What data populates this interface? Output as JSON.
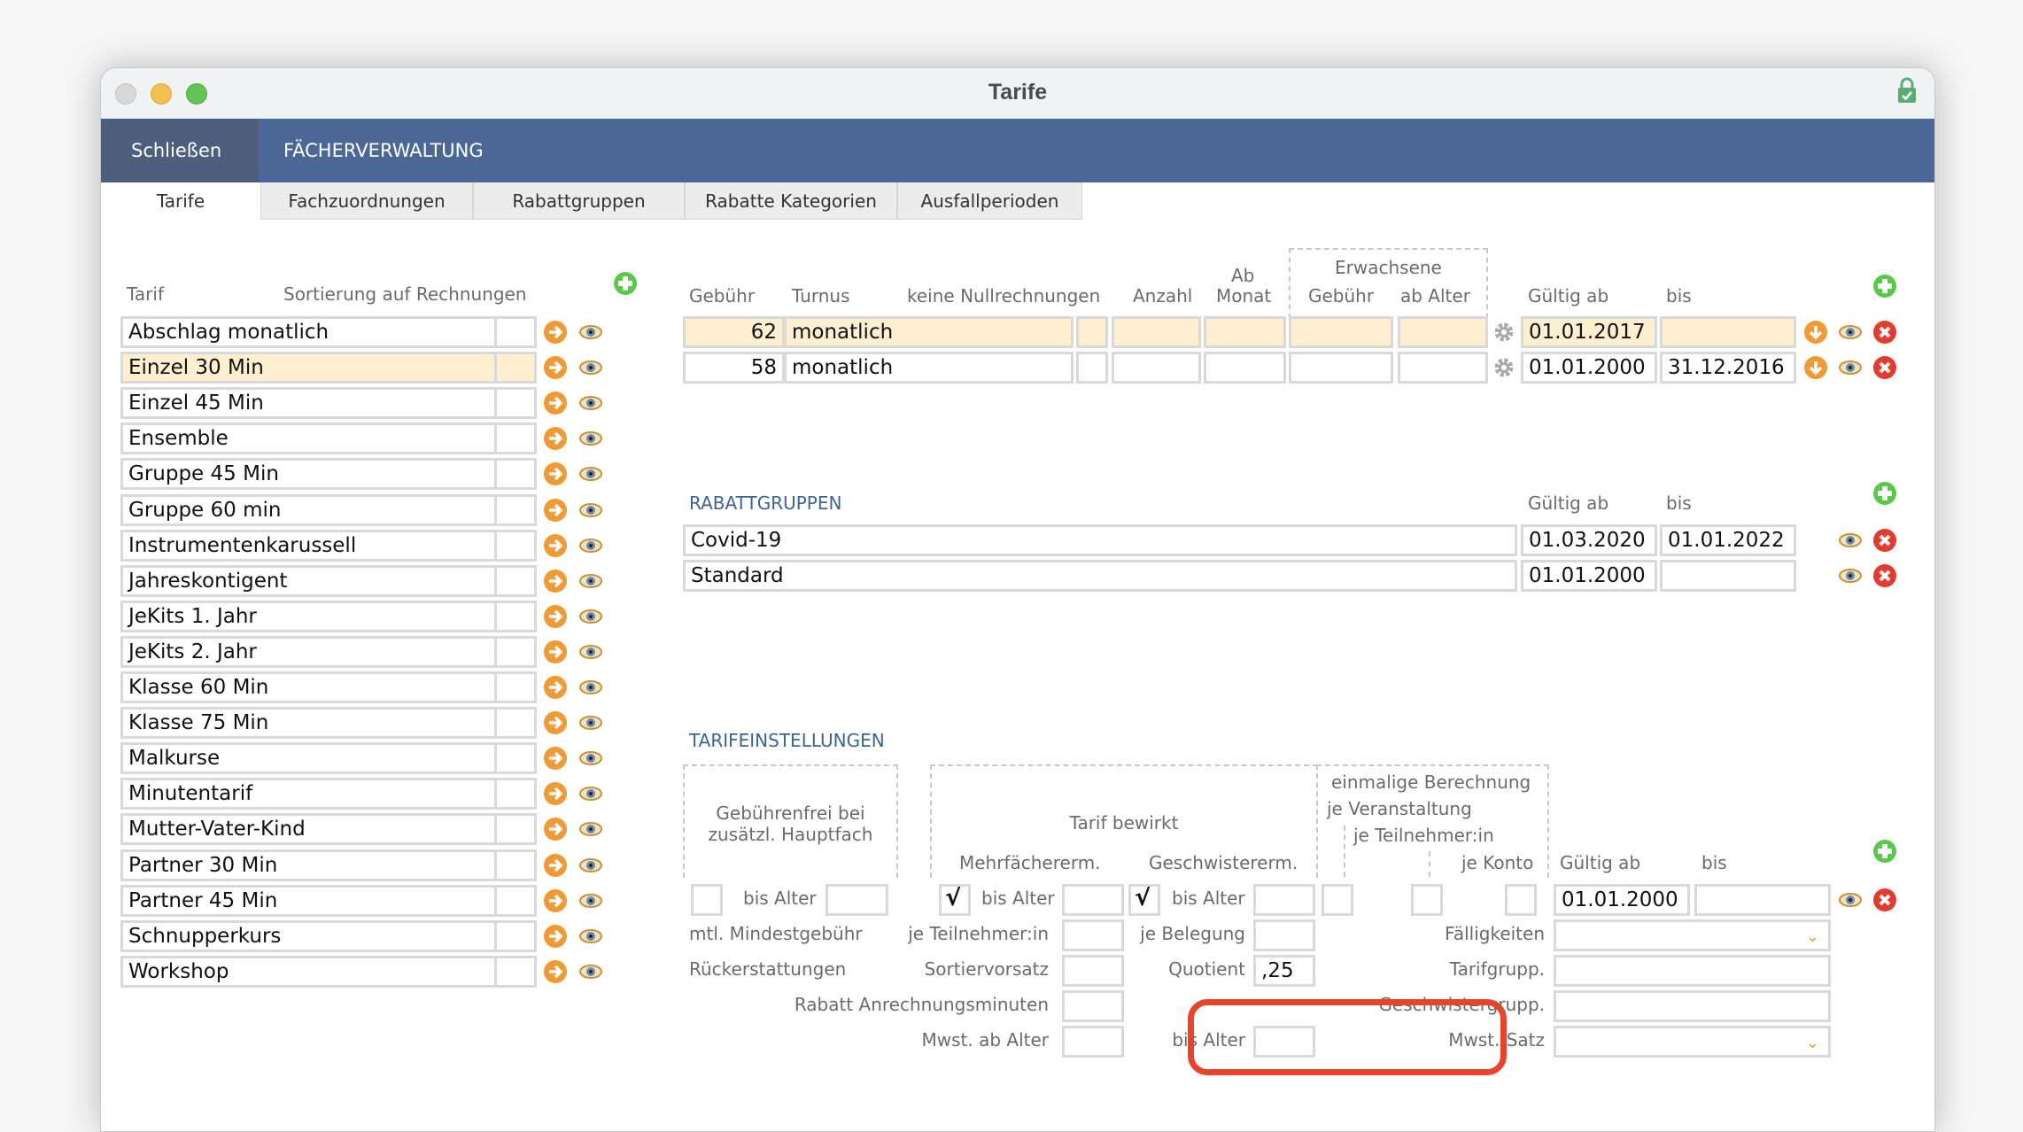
{
  "window": {
    "title": "Tarife"
  },
  "navbar": {
    "close_label": "Schließen",
    "module_label": "FÄCHERVERWALTUNG"
  },
  "tabs": [
    {
      "label": "Tarife",
      "active": true
    },
    {
      "label": "Fachzuordnungen"
    },
    {
      "label": "Rabattgruppen"
    },
    {
      "label": "Rabatte Kategorien"
    },
    {
      "label": "Ausfallperioden"
    }
  ],
  "tariff_list": {
    "headers": {
      "tarif": "Tarif",
      "sort": "Sortierung auf Rechnungen"
    },
    "selected": "Einzel 30 Min",
    "items": [
      "Abschlag monatlich",
      "Einzel 30 Min",
      "Einzel 45 Min",
      "Ensemble",
      "Gruppe 45 Min",
      "Gruppe 60 min",
      "Instrumentenkarussell",
      "Jahreskontigent",
      "JeKits 1. Jahr",
      "JeKits 2. Jahr",
      "Klasse 60 Min",
      "Klasse 75 Min",
      "Malkurse",
      "Minutentarif",
      "Mutter-Vater-Kind",
      "Partner 30 Min",
      "Partner 45 Min",
      "Schnupperkurs",
      "Workshop"
    ]
  },
  "fees": {
    "headers": {
      "gebuehr": "Gebühr",
      "turnus": "Turnus",
      "keine_null": "keine Nullrechnungen",
      "anzahl": "Anzahl",
      "ab": "Ab",
      "monat": "Monat",
      "erwachsene": "Erwachsene",
      "erw_gebuehr": "Gebühr",
      "ab_alter": "ab Alter",
      "gueltig_ab": "Gültig ab",
      "bis": "bis"
    },
    "rows": [
      {
        "gebuehr": "62",
        "turnus": "monatlich",
        "gueltig_ab": "01.01.2017",
        "bis": "",
        "highlighted": true
      },
      {
        "gebuehr": "58",
        "turnus": "monatlich",
        "gueltig_ab": "01.01.2000",
        "bis": "31.12.2016",
        "highlighted": false
      }
    ]
  },
  "rabattgruppen": {
    "title": "RABATTGRUPPEN",
    "headers": {
      "gueltig_ab": "Gültig ab",
      "bis": "bis"
    },
    "rows": [
      {
        "name": "Covid-19",
        "gueltig_ab": "01.03.2020",
        "bis": "01.01.2022"
      },
      {
        "name": "Standard",
        "gueltig_ab": "01.01.2000",
        "bis": ""
      }
    ]
  },
  "settings": {
    "title": "TARIFEINSTELLUNGEN",
    "group_gebuehrenfrei": "Gebührenfrei bei zusätzl. Hauptfach",
    "group_gebuehrenfrei_l1": "Gebührenfrei bei",
    "group_gebuehrenfrei_l2": "zusätzl. Hauptfach",
    "group_tarif_bewirkt": "Tarif bewirkt",
    "mehrfach": "Mehrfächererm.",
    "geschwister": "Geschwistererm.",
    "einmalig": "einmalige Berechnung",
    "je_veranstaltung": "je Veranstaltung",
    "je_teilnehmer": "je Teilnehmer:in",
    "je_konto": "je Konto",
    "gueltig_ab": "Gültig ab",
    "bis": "bis",
    "bis_alter": "bis Alter",
    "mehrfach_checked": true,
    "geschwister_checked": true,
    "check_glyph": "√",
    "gueltig_ab_value": "01.01.2000",
    "bis_value": "",
    "mtl_mindest": "mtl. Mindestgebühr",
    "je_teilnehmer_in": "je Teilnehmer:in",
    "je_belegung": "je Belegung",
    "faelligkeiten": "Fälligkeiten",
    "rueckerstattungen": "Rückerstattungen",
    "sortiervorsatz": "Sortiervorsatz",
    "quotient": "Quotient",
    "quotient_value": ",25",
    "tarifgrupp": "Tarifgrupp.",
    "rabatt_minuten": "Rabatt Anrechnungsminuten",
    "geschwistergrupp": "Geschwistergrupp.",
    "mwst_ab_alter": "Mwst. ab Alter",
    "mwst_satz": "Mwst.-Satz"
  },
  "colors": {
    "navbar": "#4b6795",
    "highlight_row": "#fdefd0",
    "section_title": "#3f6296",
    "add_icon": "#5ac84b",
    "delete_icon": "#e53a2d",
    "arrow_icon": "#ef9a35",
    "annotation": "#e8432c"
  }
}
